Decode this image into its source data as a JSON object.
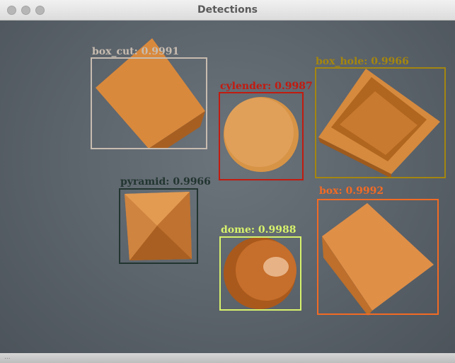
{
  "window": {
    "title": "Detections"
  },
  "detections": [
    {
      "name": "box_cut",
      "label": "box_cut: 0.9991",
      "color": "#c7bcb0"
    },
    {
      "name": "cylender",
      "label": "cylender: 0.9987",
      "color": "#c21b10"
    },
    {
      "name": "box_hole",
      "label": "box_hole: 0.9966",
      "color": "#a4860f"
    },
    {
      "name": "pyramid",
      "label": "pyramid: 0.9966",
      "color": "#223530"
    },
    {
      "name": "box",
      "label": "box: 0.9992",
      "color": "#f26b24"
    },
    {
      "name": "dome",
      "label": "dome: 0.9988",
      "color": "#d7f26c"
    }
  ],
  "bottom_bar": {
    "text": "..."
  }
}
